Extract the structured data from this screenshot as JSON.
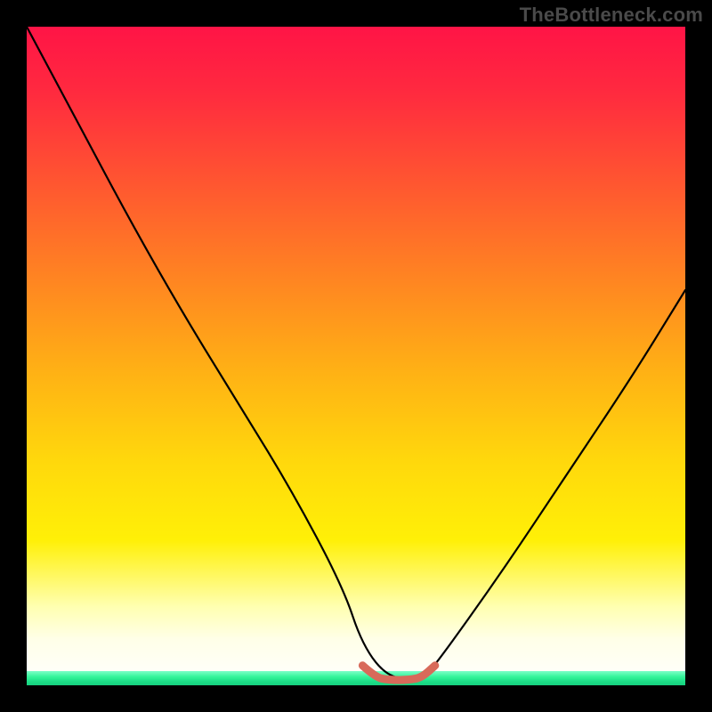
{
  "watermark": "TheBottleneck.com",
  "chart_data": {
    "type": "line",
    "title": "",
    "xlabel": "",
    "ylabel": "",
    "xlim": [
      0,
      100
    ],
    "ylim": [
      0,
      100
    ],
    "grid": false,
    "series": [
      {
        "name": "bottleneck-curve",
        "type": "line",
        "color": "#000000",
        "x": [
          0,
          8,
          16,
          24,
          32,
          40,
          48,
          51,
          55,
          60,
          62,
          72,
          82,
          92,
          100
        ],
        "values": [
          100,
          85,
          70,
          56,
          43,
          30,
          15,
          6,
          1,
          1,
          3,
          17,
          32,
          47,
          60
        ]
      },
      {
        "name": "flat-valley-marker",
        "type": "line",
        "color": "#d86a5a",
        "x": [
          51,
          53,
          55,
          58,
          60,
          62
        ],
        "values": [
          3,
          1.2,
          0.8,
          0.8,
          1.2,
          3
        ]
      }
    ],
    "gradient_stops": [
      {
        "pct": 0,
        "color": "#ff1446"
      },
      {
        "pct": 25,
        "color": "#ff5a2f"
      },
      {
        "pct": 52,
        "color": "#ffb015"
      },
      {
        "pct": 78,
        "color": "#fff007"
      },
      {
        "pct": 93,
        "color": "#ffffe8"
      },
      {
        "pct": 98,
        "color": "#7dffc8"
      },
      {
        "pct": 100,
        "color": "#16d07f"
      }
    ]
  }
}
